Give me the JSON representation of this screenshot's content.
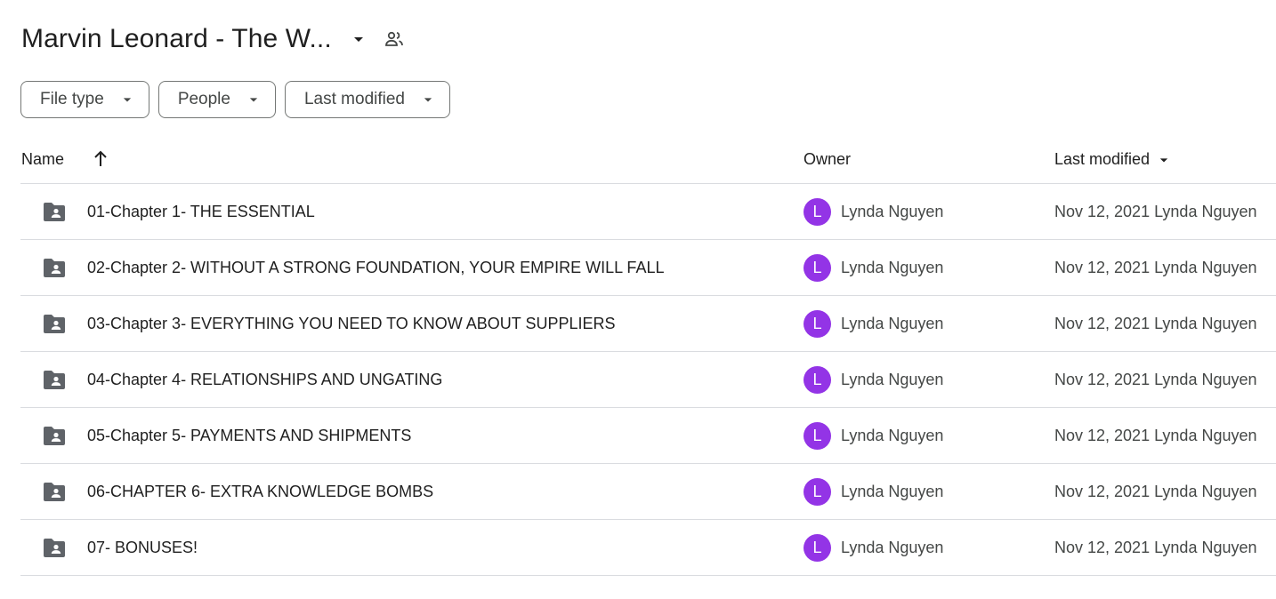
{
  "header": {
    "title": "Marvin Leonard - The W...",
    "caret_icon": "arrow-drop-down-icon",
    "shared_icon": "people-icon"
  },
  "filters": [
    {
      "label": "File type"
    },
    {
      "label": "People"
    },
    {
      "label": "Last modified"
    }
  ],
  "columns": {
    "name": "Name",
    "owner": "Owner",
    "last_modified": "Last modified",
    "name_sort_icon": "arrow-upward-icon"
  },
  "rows": [
    {
      "name": "01-Chapter 1- THE ESSENTIAL",
      "owner_initial": "L",
      "owner": "Lynda Nguyen",
      "modified": "Nov 12, 2021 Lynda Nguyen"
    },
    {
      "name": "02-Chapter 2- WITHOUT A STRONG FOUNDATION, YOUR EMPIRE WILL FALL",
      "owner_initial": "L",
      "owner": "Lynda Nguyen",
      "modified": "Nov 12, 2021 Lynda Nguyen"
    },
    {
      "name": "03-Chapter 3- EVERYTHING YOU NEED TO KNOW ABOUT SUPPLIERS",
      "owner_initial": "L",
      "owner": "Lynda Nguyen",
      "modified": "Nov 12, 2021 Lynda Nguyen"
    },
    {
      "name": "04-Chapter 4- RELATIONSHIPS AND UNGATING",
      "owner_initial": "L",
      "owner": "Lynda Nguyen",
      "modified": "Nov 12, 2021 Lynda Nguyen"
    },
    {
      "name": "05-Chapter 5- PAYMENTS AND SHIPMENTS",
      "owner_initial": "L",
      "owner": "Lynda Nguyen",
      "modified": "Nov 12, 2021 Lynda Nguyen"
    },
    {
      "name": "06-CHAPTER 6- EXTRA KNOWLEDGE BOMBS",
      "owner_initial": "L",
      "owner": "Lynda Nguyen",
      "modified": "Nov 12, 2021 Lynda Nguyen"
    },
    {
      "name": "07- BONUSES!",
      "owner_initial": "L",
      "owner": "Lynda Nguyen",
      "modified": "Nov 12, 2021 Lynda Nguyen"
    }
  ],
  "colors": {
    "avatar": "#9334e6",
    "text_primary": "#1f1f1f",
    "text_secondary": "#444746",
    "divider": "#dadce0",
    "folder_icon": "#5f6368"
  }
}
